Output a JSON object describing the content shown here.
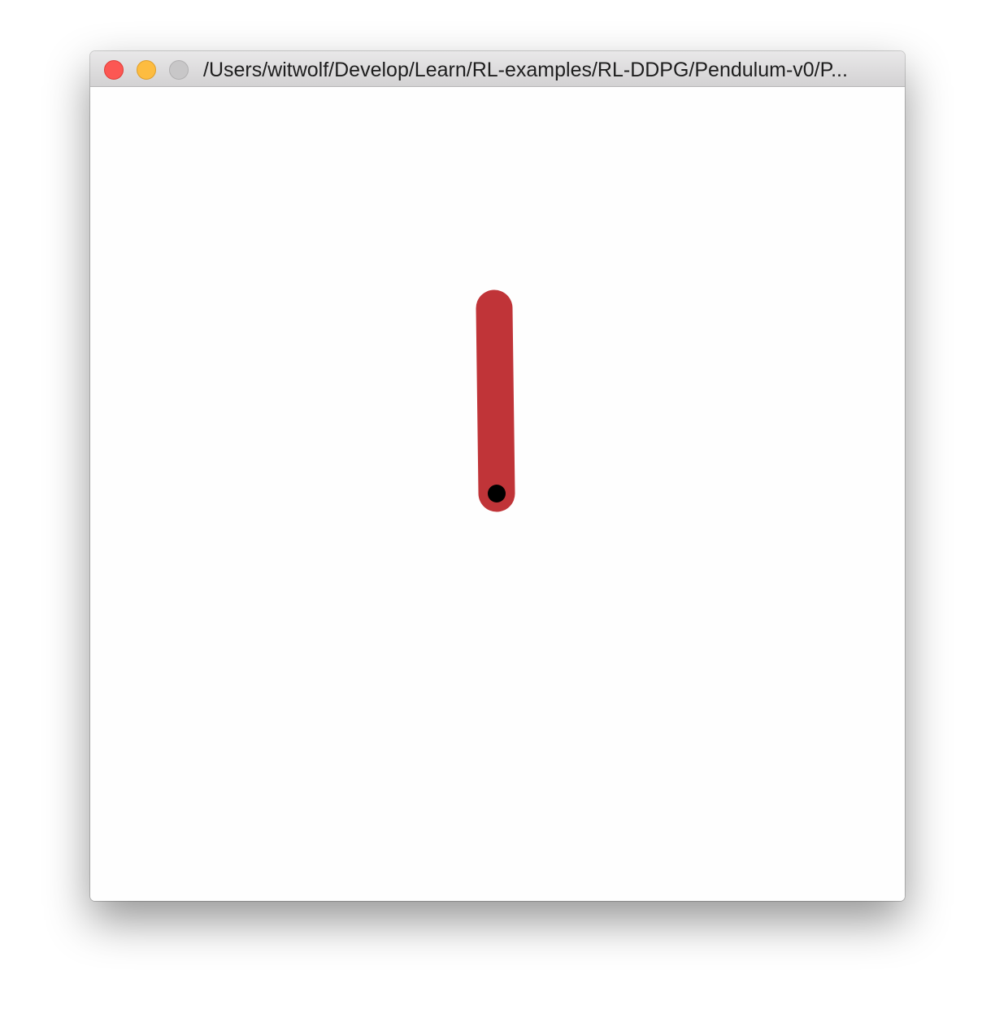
{
  "window": {
    "title": "/Users/witwolf/Develop/Learn/RL-examples/RL-DDPG/Pendulum-v0/P..."
  },
  "render": {
    "pole_color": "#c03438",
    "axle_color": "#000000",
    "background_color": "#fefefe"
  }
}
